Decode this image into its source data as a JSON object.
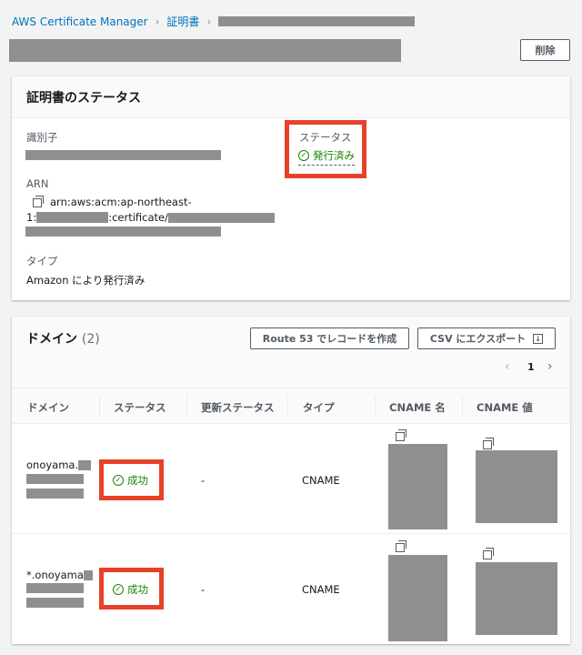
{
  "breadcrumb": {
    "service": "AWS Certificate Manager",
    "section": "証明書"
  },
  "header": {
    "delete_label": "削除"
  },
  "status_panel": {
    "title": "証明書のステータス",
    "identifier_label": "識別子",
    "arn_label": "ARN",
    "arn_line1": "arn:aws:acm:ap-northeast-",
    "arn_prefix": "1:",
    "arn_mid": ":certificate/",
    "type_label": "タイプ",
    "type_value": "Amazon により発行済み",
    "status_label": "ステータス",
    "status_value": "発行済み"
  },
  "domains": {
    "title": "ドメイン",
    "count": "(2)",
    "route53_label": "Route 53 でレコードを作成",
    "csv_label": "CSV にエクスポート",
    "page": "1",
    "columns": [
      "ドメイン",
      "ステータス",
      "更新ステータス",
      "タイプ",
      "CNAME 名",
      "CNAME 値"
    ],
    "rows": [
      {
        "domain": "onoyama.",
        "status": "成功",
        "renewal": "-",
        "type": "CNAME"
      },
      {
        "domain": "*.onoyama",
        "status": "成功",
        "renewal": "-",
        "type": "CNAME"
      }
    ]
  },
  "colors": {
    "link": "#0073bb",
    "success": "#1d8102",
    "highlight": "#e8412a"
  }
}
